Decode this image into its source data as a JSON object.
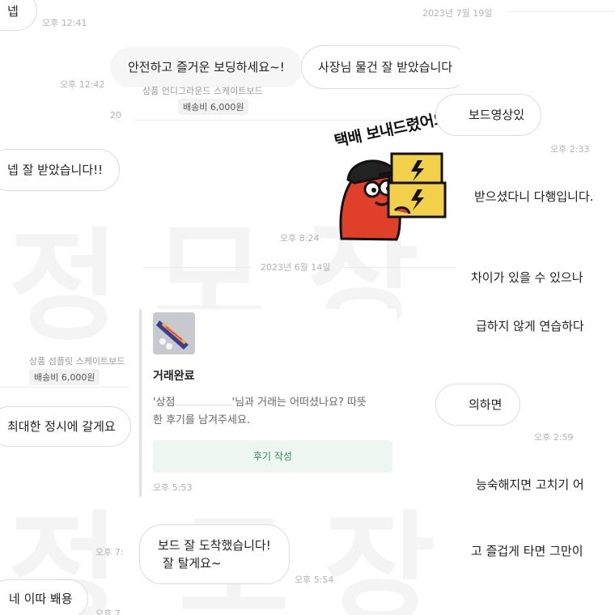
{
  "dates": {
    "top_right": "2023년 7월 19일",
    "middle": "2023년 6월 14일",
    "left_partial": "20"
  },
  "left_column": {
    "bubble_top": "넵",
    "time_1": "오후 12:41",
    "time_2": "오후 12:42",
    "bubble_received": "넵 잘 받았습니다!!",
    "product_partial": "상품 섬플릿 스케이트보드",
    "ship_fee": "배송비 6,000원",
    "bubble_ontime": "최대한 정시에 갈게요",
    "time_3": "오후 7:",
    "bubble_ddappong": "네 이따 봬용",
    "time_4": "오후 7"
  },
  "middle_column": {
    "bubble_safe": "안전하고 즐거운 보딩하세요~!",
    "bubble_received_boss": "사장님 물건 잘 받았습니다",
    "product_partial": "상품 언디그라운드 스케이트보드",
    "ship_fee": "배송비 6,000원",
    "sticker_text": "택배 보내드렸어요",
    "time_sticker": "오후 8:24",
    "card": {
      "title": "거래완료",
      "body_line1_pre": "'상점",
      "body_line1_post": "'님과 거래는 어떠셨나요? 따뜻",
      "body_line2": "한 후기를 남겨주세요.",
      "button": "후기 작성",
      "time": "오후 5:53"
    },
    "bubble_arrived_1": "보드 잘 도착했습니다!",
    "bubble_arrived_2": "잘 탈게요~",
    "time_arrived": "오후 5:54"
  },
  "right_column": {
    "line1": "보드영상있",
    "time1": "오후 2:33",
    "line2": "받으셨다니 다행입니다.",
    "line3": "차이가 있을 수 있으나",
    "line4": "급하지 않게 연습하다",
    "line5": "의하면",
    "time2": "오후 2:59",
    "line6": "능숙해지면 고치기 어",
    "line7": "고 즐겁게 타면 그만이"
  },
  "watermark": {
    "chars": [
      "정",
      "모",
      "장",
      "정",
      "모",
      "장"
    ]
  },
  "colors": {
    "accent_green": "#2e8b57",
    "review_bg": "#eef6f2",
    "sticker_red": "#e0402a",
    "sticker_box": "#f3d04a"
  }
}
